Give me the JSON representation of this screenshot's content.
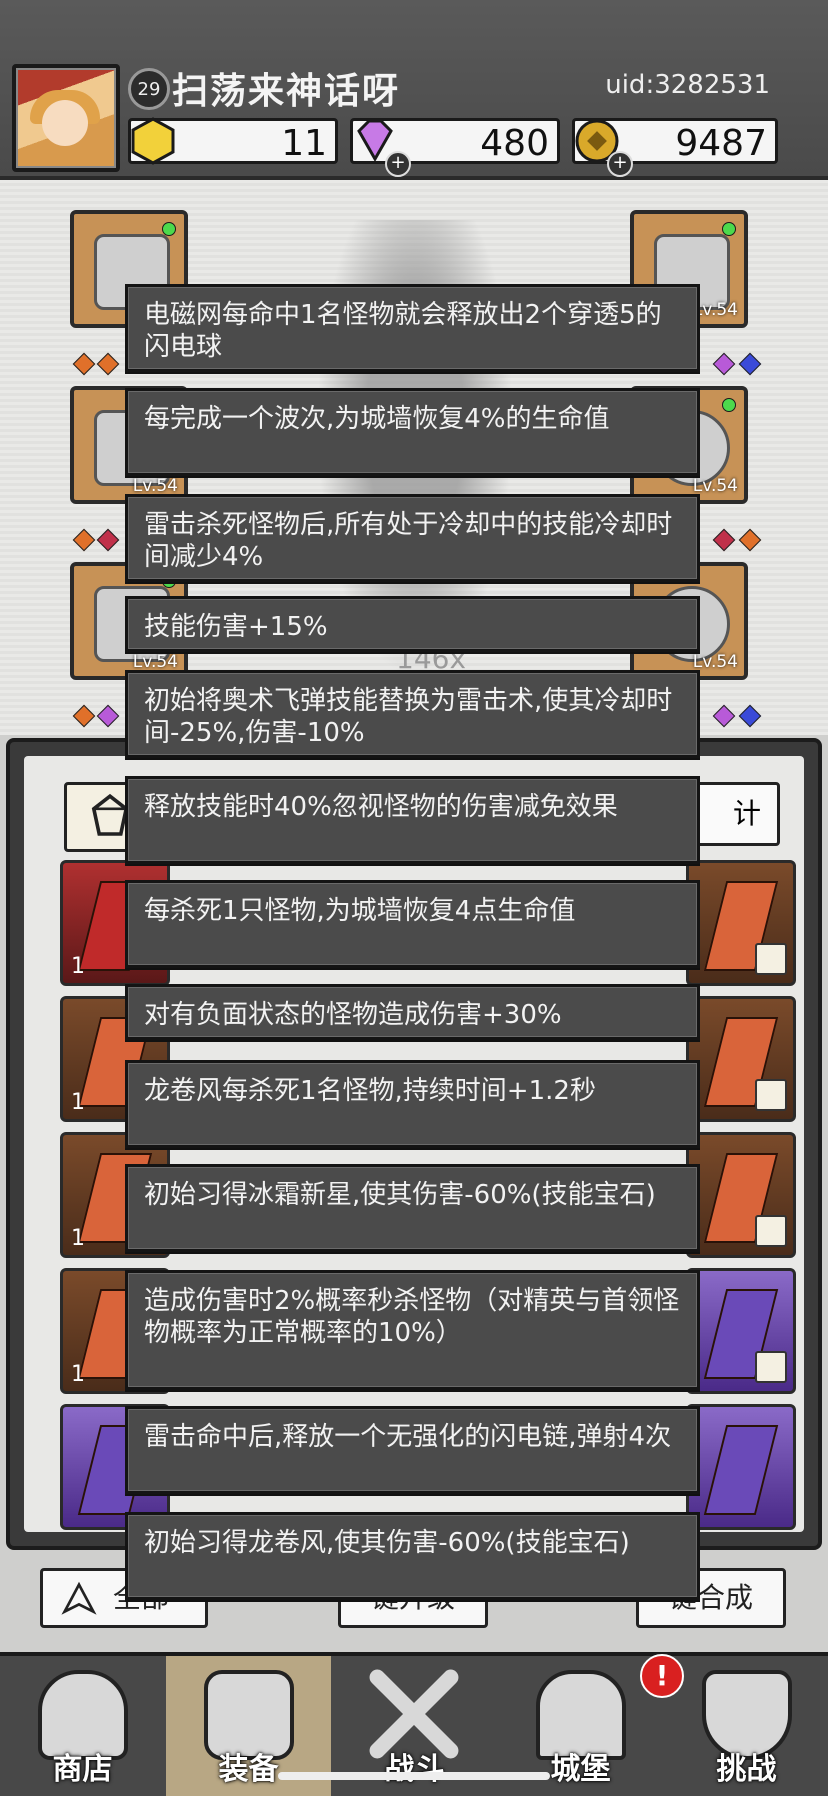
{
  "header": {
    "level": "29",
    "player_name": "扫荡来神话呀",
    "uid": "uid:3282531",
    "resources": [
      {
        "icon": "gold-hexagon-icon",
        "value": "11"
      },
      {
        "icon": "purple-diamond-icon",
        "value": "480"
      },
      {
        "icon": "gold-coin-icon",
        "value": "9487"
      }
    ]
  },
  "equipment": {
    "levels": [
      "Lv.54",
      "Lv.54",
      "Lv.54",
      "Lv.54",
      "Lv.54"
    ],
    "center_text": "146x"
  },
  "inventory": {
    "right_button": "计",
    "count_label": "1"
  },
  "bottom_buttons": {
    "filter": "全部",
    "upgrade": "键升级",
    "merge": "键合成"
  },
  "tabs": [
    {
      "label": "商店",
      "icon": "shop-icon"
    },
    {
      "label": "装备",
      "icon": "backpack-icon"
    },
    {
      "label": "战斗",
      "icon": "crossed-swords-icon"
    },
    {
      "label": "城堡",
      "icon": "castle-icon"
    },
    {
      "label": "挑战",
      "icon": "shield-icon"
    }
  ],
  "notification_badge": "!",
  "tooltips": [
    "电磁网每命中1名怪物就会释放出2个穿透5的闪电球",
    "每完成一个波次,为城墙恢复4%的生命值",
    "雷击杀死怪物后,所有处于冷却中的技能冷却时间减少4%",
    "技能伤害+15%",
    "初始将奥术飞弹技能替换为雷击术,使其冷却时间-25%,伤害-10%",
    "释放技能时40%忽视怪物的伤害减免效果",
    "每杀死1只怪物,为城墙恢复4点生命值",
    "对有负面状态的怪物造成伤害+30%",
    "龙卷风每杀死1名怪物,持续时间+1.2秒",
    "初始习得冰霜新星,使其伤害-60%(技能宝石)",
    "造成伤害时2%概率秒杀怪物（对精英与首领怪物概率为正常概率的10%）",
    "雷击命中后,释放一个无强化的闪电链,弹射4次",
    "初始习得龙卷风,使其伤害-60%(技能宝石)"
  ]
}
